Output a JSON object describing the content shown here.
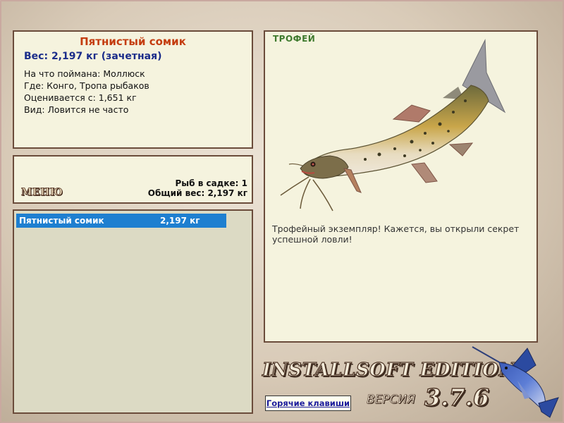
{
  "fish": {
    "name": "Пятнистый сомик",
    "weight_line": "Вес: 2,197 кг (зачетная)",
    "bait_line": "На что поймана: Моллюск",
    "location_line": "Где: Конго, Тропа рыбаков",
    "valued_line": "Оценивается с: 1,651 кг",
    "kind_line": "Вид: Ловится не часто"
  },
  "menu": {
    "menu_label": "МЕНЮ",
    "fish_in_keepnet": "Рыб в садке: 1",
    "total_weight": "Общий вес: 2,197 кг"
  },
  "catch_list": [
    {
      "name": "Пятнистый сомик",
      "weight": "2,197 кг",
      "selected": true
    }
  ],
  "trophy": {
    "label": "ТРОФЕЙ",
    "text": "Трофейный экземпляр! Кажется, вы открыли секрет успешной ловли!"
  },
  "footer": {
    "edition": "INSTALLSOFT EDITION",
    "version_label": "ВЕРСИЯ",
    "version_number": "3.7.6",
    "hotkeys_label": "Горячие клавиши"
  },
  "icons": {
    "fish_image": "catfish-icon",
    "logo": "marlin-icon"
  },
  "colors": {
    "title": "#c43d10",
    "weight": "#1b2d8a",
    "selection": "#1e7fd0",
    "trophy_label": "#3f7a2e",
    "panel_border": "#6b4c3b"
  }
}
